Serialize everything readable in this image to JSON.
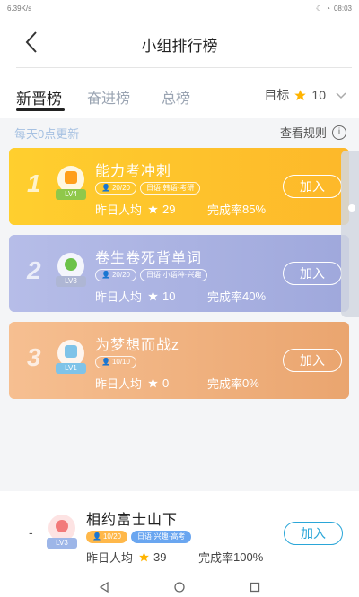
{
  "status_bar": {
    "left": "6.39K/s",
    "time": "08:03"
  },
  "header": {
    "title": "小组排行榜"
  },
  "tabs": [
    {
      "label": "新晋榜",
      "active": true
    },
    {
      "label": "奋进榜",
      "active": false
    },
    {
      "label": "总榜",
      "active": false
    }
  ],
  "goal": {
    "label": "目标",
    "value": "10"
  },
  "notice": {
    "update_text": "每天0点更新",
    "rules_label": "查看规则",
    "info_glyph": "i"
  },
  "colors": {
    "accent_yellow": "#fdb82a",
    "accent_blue": "#2aa6d8",
    "star": "#ffb400"
  },
  "groups": [
    {
      "rank": "1",
      "level": "LV4",
      "name": "能力考冲刺",
      "members": "20/20",
      "tags": [
        "日语·韩语·考研"
      ],
      "avg_label": "昨日人均",
      "avg_value": "29",
      "rate_label": "完成率",
      "rate_value": "85%",
      "join_label": "加入",
      "avatar_icon": "book-icon"
    },
    {
      "rank": "2",
      "level": "LV3",
      "name": "卷生卷死背单词",
      "members": "20/20",
      "tags": [
        "日语·小语种·兴趣"
      ],
      "avg_label": "昨日人均",
      "avg_value": "10",
      "rate_label": "完成率",
      "rate_value": "40%",
      "join_label": "加入",
      "avatar_icon": "plant-icon"
    },
    {
      "rank": "3",
      "level": "LV1",
      "name": "为梦想而战z",
      "members": "10/10",
      "tags": [],
      "avg_label": "昨日人均",
      "avg_value": "0",
      "rate_label": "完成率",
      "rate_value": "0%",
      "join_label": "加入",
      "avatar_icon": "calendar-icon"
    }
  ],
  "my_group": {
    "rank": "-",
    "level": "LV3",
    "name": "相约富士山下",
    "members": "10/20",
    "tags": [
      "日语·兴趣·高考"
    ],
    "avg_label": "昨日人均",
    "avg_value": "39",
    "rate_label": "完成率",
    "rate_value": "100%",
    "join_label": "加入",
    "avatar_icon": "alarm-clock-icon"
  },
  "nav": {
    "back_icon": "triangle-back-icon",
    "home_icon": "circle-home-icon",
    "recent_icon": "square-recent-icon"
  }
}
